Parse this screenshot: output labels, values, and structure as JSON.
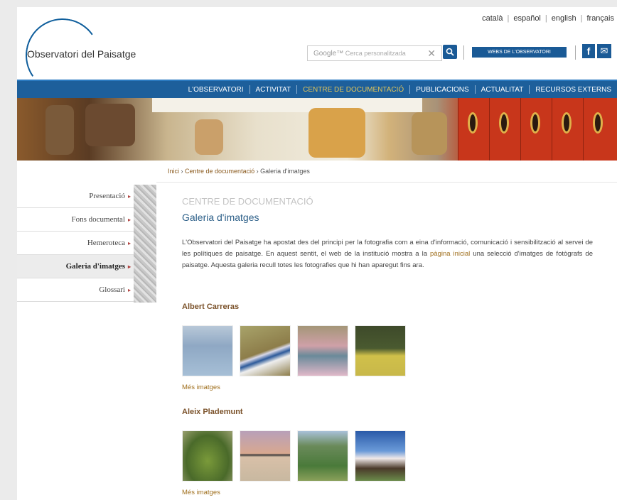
{
  "header": {
    "logo_text": "Observatori del Paisatge",
    "languages": [
      "català",
      "español",
      "english",
      "français"
    ],
    "search_brand": "Google™",
    "search_placeholder": "Cerca personalitzada",
    "search_clear": "✕",
    "webs_button": "WEBS DE L'OBSERVATORI",
    "facebook_label": "f",
    "mail_label": "✉"
  },
  "nav": {
    "items": [
      {
        "label": "L'OBSERVATORI",
        "active": false
      },
      {
        "label": "ACTIVITAT",
        "active": false
      },
      {
        "label": "CENTRE DE DOCUMENTACIÓ",
        "active": true
      },
      {
        "label": "PUBLICACIONS",
        "active": false
      },
      {
        "label": "ACTUALITAT",
        "active": false
      },
      {
        "label": "RECURSOS EXTERNS",
        "active": false
      }
    ]
  },
  "breadcrumb": {
    "home": "Inici",
    "sep": " › ",
    "section": "Centre de documentació",
    "current": "Galeria d'imatges"
  },
  "sidebar": {
    "items": [
      {
        "label": "Presentació",
        "active": false
      },
      {
        "label": "Fons documental",
        "active": false
      },
      {
        "label": "Hemeroteca",
        "active": false
      },
      {
        "label": "Galeria d'imatges",
        "active": true
      },
      {
        "label": "Glossari",
        "active": false
      }
    ],
    "arrow": "▸"
  },
  "main": {
    "section_label": "CENTRE DE DOCUMENTACIÓ",
    "title": "Galeria d'imatges",
    "intro_part1": "L'Observatori del Paisatge ha apostat des del principi per la fotografia com a eina d'informació, comunicació i sensibilització al servei de les polítiques de paisatge. En aquest sentit, el web de la institució mostra a la ",
    "intro_link": "pàgina inicial",
    "intro_part2": " una selecció d'imatges de fotògrafs de paisatge. Aquesta galeria recull totes les fotografies que hi han aparegut fins ara.",
    "galleries": [
      {
        "photographer": "Albert Carreras",
        "more_label": "Més imatges",
        "thumb_colors": [
          "#9fb7cf",
          "#a7a46a",
          "#9a8a72",
          "#c9b84a"
        ]
      },
      {
        "photographer": "Aleix Plademunt",
        "more_label": "Més imatges",
        "thumb_colors": [
          "#6f8a3a",
          "#c7a392",
          "#5f8a4d",
          "#3a6aa8"
        ]
      }
    ]
  },
  "colors": {
    "brand_blue": "#1d5f9b",
    "accent_gold": "#e0c45a",
    "link_brown": "#a0701e",
    "title_blue": "#2c5f88"
  }
}
